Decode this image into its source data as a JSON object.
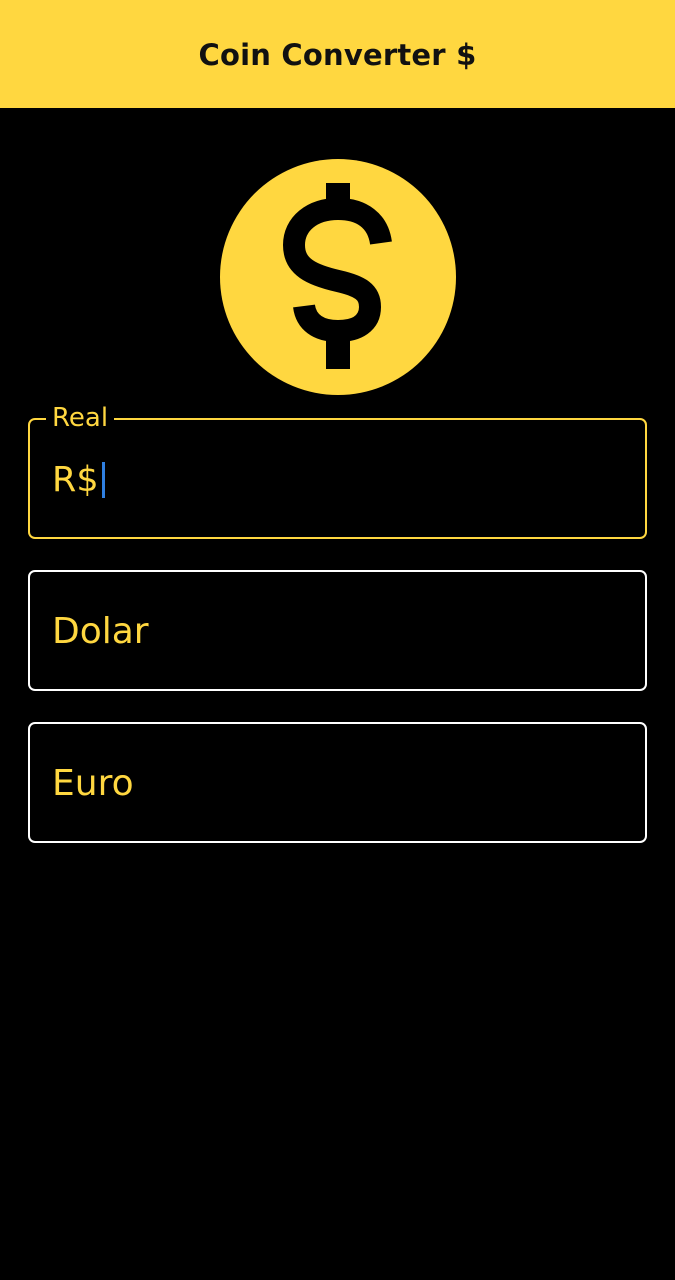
{
  "app_bar": {
    "title": "Coin Converter $"
  },
  "logo": {
    "icon": "dollar-coin-icon",
    "color": "#FFD740"
  },
  "fields": {
    "real": {
      "label": "Real",
      "prefix": "R$",
      "value": "",
      "focused": true
    },
    "dolar": {
      "label": "Dolar",
      "focused": false
    },
    "euro": {
      "label": "Euro",
      "focused": false
    }
  },
  "colors": {
    "accent": "#FFD740",
    "background": "#000000",
    "idle_border": "#FFFFFF",
    "caret": "#2F7FE0"
  }
}
